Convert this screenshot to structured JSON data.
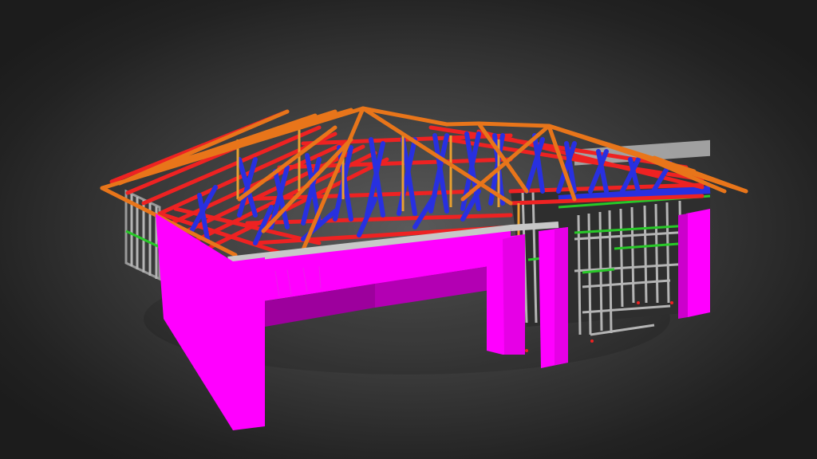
{
  "viewer": {
    "background_center": "#5a5a5a",
    "background_edge": "#1c1c1c"
  },
  "model": {
    "subject": "house-frame-3d-model",
    "colors": {
      "walls": "#ff00ff",
      "wall_shade": "#b300b3",
      "wall_dark": "#9d009d",
      "steel_frame": "#b4b4b4",
      "top_plate": "#c8c8c8",
      "hip_rafters": "#e8751a",
      "truss_chords": "#ee2222",
      "truss_webs": "#2830e0",
      "noggings": "#28c828",
      "posts": "#e8a030"
    }
  }
}
